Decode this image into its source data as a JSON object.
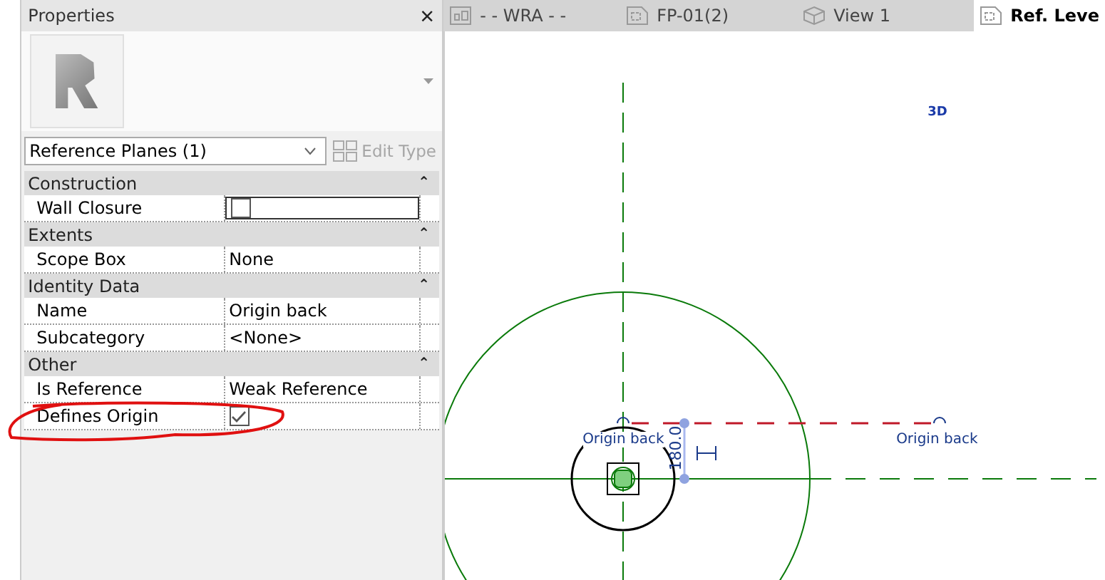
{
  "properties": {
    "title": "Properties",
    "close": "×",
    "type_selector": "Reference Planes (1)",
    "edit_type": {
      "label": "Edit Type",
      "disabled": true
    },
    "groups": [
      {
        "name": "Construction",
        "collapse": "⌃",
        "rows": [
          {
            "kind": "checkbox",
            "label": "Wall Closure",
            "checked": false,
            "active": true
          }
        ]
      },
      {
        "name": "Extents",
        "collapse": "⌃",
        "rows": [
          {
            "kind": "text",
            "label": "Scope Box",
            "value": "None"
          }
        ]
      },
      {
        "name": "Identity Data",
        "collapse": "⌃",
        "rows": [
          {
            "kind": "text",
            "label": "Name",
            "value": "Origin back"
          },
          {
            "kind": "text",
            "label": "Subcategory",
            "value": "<None>"
          }
        ]
      },
      {
        "name": "Other",
        "collapse": "⌃",
        "rows": [
          {
            "kind": "text",
            "label": "Is Reference",
            "value": "Weak Reference"
          },
          {
            "kind": "checkbox",
            "label": "Defines Origin",
            "checked": true,
            "active": false
          }
        ]
      }
    ]
  },
  "tabs": [
    {
      "label": "- - WRA - -",
      "kind": "plan",
      "selected": false
    },
    {
      "label": "FP-01(2)",
      "kind": "sheet",
      "selected": false
    },
    {
      "label": "View 1",
      "kind": "cube",
      "selected": false
    },
    {
      "label": "Ref. Leve",
      "kind": "sheet",
      "selected": true
    }
  ],
  "canvas": {
    "view_cube": "3D",
    "plane_labels": [
      "Origin back",
      "Origin back"
    ],
    "dimension": "180.0"
  }
}
